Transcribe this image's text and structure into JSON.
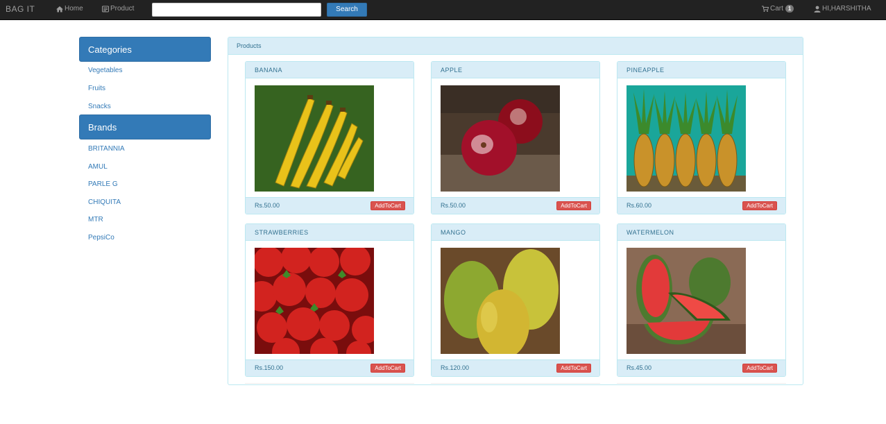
{
  "navbar": {
    "brand": "BAG IT",
    "home_label": "Home",
    "product_label": "Product",
    "search_placeholder": "",
    "search_button": "Search",
    "cart_label": "Cart",
    "cart_count": "1",
    "user_label": "HI,HARSHITHA"
  },
  "sidebar": {
    "categories_title": "Categories",
    "categories": [
      "Vegetables",
      "Fruits",
      "Snacks"
    ],
    "brands_title": "Brands",
    "brands": [
      "BRITANNIA",
      "AMUL",
      "PARLE G",
      "CHIQUITA",
      "MTR",
      "PepsiCo"
    ]
  },
  "products_panel": {
    "title": "Products",
    "items": [
      {
        "name": "BANANA",
        "price": "Rs.50.00",
        "button": "AddToCart"
      },
      {
        "name": "APPLE",
        "price": "Rs.50.00",
        "button": "AddToCart"
      },
      {
        "name": "PINEAPPLE",
        "price": "Rs.60.00",
        "button": "AddToCart"
      },
      {
        "name": "STRAWBERRIES",
        "price": "Rs.150.00",
        "button": "AddToCart"
      },
      {
        "name": "MANGO",
        "price": "Rs.120.00",
        "button": "AddToCart"
      },
      {
        "name": "WATERMELON",
        "price": "Rs.45.00",
        "button": "AddToCart"
      }
    ]
  }
}
